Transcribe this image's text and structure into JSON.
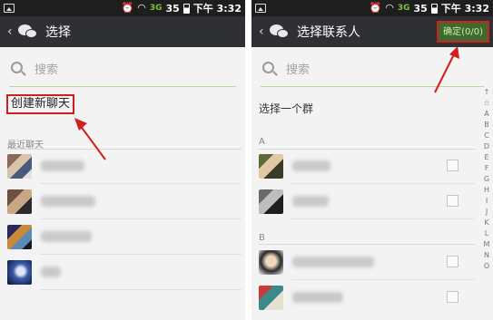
{
  "status_bar": {
    "signal_label": "3G",
    "battery": "35",
    "time": "下午 3:32"
  },
  "left": {
    "title": "选择",
    "search_placeholder": "搜索",
    "create_chat": "创建新聊天",
    "recent_header": "最近聊天"
  },
  "right": {
    "title": "选择联系人",
    "confirm": "确定(0/0)",
    "search_placeholder": "搜索",
    "select_group": "选择一个群",
    "section_a": "A",
    "section_b": "B",
    "alphabet": [
      "↑",
      "☆",
      "A",
      "B",
      "C",
      "D",
      "E",
      "F",
      "G",
      "H",
      "I",
      "J",
      "K",
      "L",
      "M",
      "N",
      "O"
    ]
  },
  "colors": {
    "title_bar": "#2f3034",
    "highlight_red": "#d01f1f",
    "confirm_green": "#3d6b2e"
  },
  "icons": [
    "picture-icon",
    "alarm-icon",
    "wifi-icon",
    "signal-icon",
    "battery-icon",
    "back-icon",
    "wechat-icon",
    "search-icon"
  ]
}
